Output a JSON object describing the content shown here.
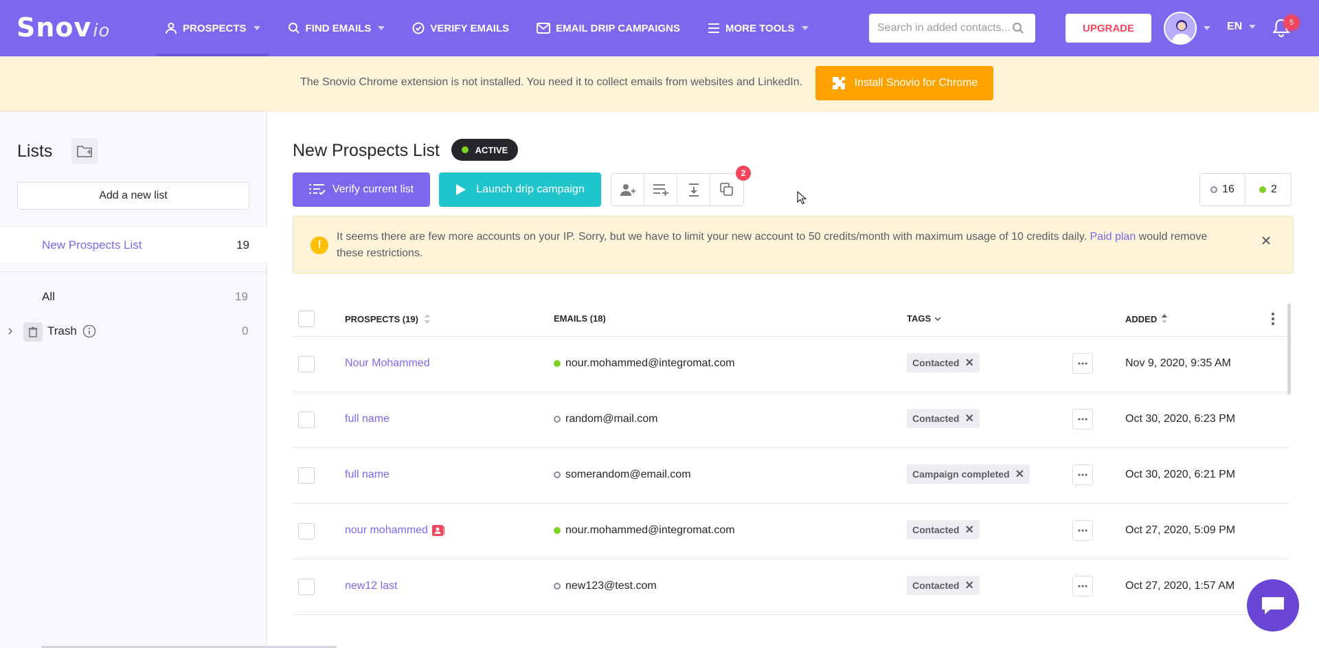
{
  "app": {
    "logo_main": "Snov",
    "logo_suffix": "io"
  },
  "nav": [
    {
      "label": "PROSPECTS"
    },
    {
      "label": "FIND EMAILS"
    },
    {
      "label": "VERIFY EMAILS"
    },
    {
      "label": "EMAIL DRIP CAMPAIGNS"
    },
    {
      "label": "MORE TOOLS"
    }
  ],
  "header": {
    "search_placeholder": "Search in added contacts...",
    "upgrade_label": "UPGRADE",
    "language": "EN",
    "notifications_count": "5"
  },
  "extension_banner": {
    "text": "The Snovio Chrome extension is not installed. You need it to collect emails from websites and LinkedIn.",
    "button_label": "Install Snovio for Chrome"
  },
  "sidebar": {
    "title": "Lists",
    "add_list_label": "Add a new list",
    "active_list": {
      "name": "New Prospects List",
      "count": "19"
    },
    "all": {
      "name": "All",
      "count": "19"
    },
    "trash": {
      "name": "Trash",
      "count": "0"
    }
  },
  "main": {
    "list_title": "New Prospects List",
    "status": "ACTIVE",
    "verify_label": "Verify current list",
    "drip_label": "Launch drip campaign",
    "tools_badge": "2",
    "counter_unverified": "16",
    "counter_valid": "2"
  },
  "warning": {
    "text_before": "It seems there are few more accounts on your IP. Sorry, but we have to limit your new account to 50 credits/month with maximum usage of 10 credits daily. ",
    "link": "Paid plan",
    "text_after": " would remove these restrictions."
  },
  "table": {
    "headers": {
      "prospects": "PROSPECTS (19)",
      "emails": "EMAILS (18)",
      "tags": "TAGS",
      "added": "ADDED"
    },
    "rows": [
      {
        "name": "Nour Mohammed",
        "email": "nour.mohammed@integromat.com",
        "email_status": "valid",
        "tag": "Contacted",
        "added": "Nov 9, 2020, 9:35 AM"
      },
      {
        "name": "full name",
        "email": "random@mail.com",
        "email_status": "unknown",
        "tag": "Contacted",
        "added": "Oct 30, 2020, 6:23 PM"
      },
      {
        "name": "full name",
        "email": "somerandom@email.com",
        "email_status": "unknown",
        "tag": "Campaign completed",
        "added": "Oct 30, 2020, 6:21 PM"
      },
      {
        "name": "nour mohammed",
        "email": "nour.mohammed@integromat.com",
        "email_status": "valid",
        "tag": "Contacted",
        "added": "Oct 27, 2020, 5:09 PM"
      },
      {
        "name": "new12 last",
        "email": "new123@test.com",
        "email_status": "unknown",
        "tag": "Contacted",
        "added": "Oct 27, 2020, 1:57 AM"
      }
    ]
  },
  "colors": {
    "brand": "#7b68ee",
    "teal": "#20c4cb",
    "orange": "#ffa200",
    "valid": "#7ed321",
    "danger": "#f5445c"
  }
}
